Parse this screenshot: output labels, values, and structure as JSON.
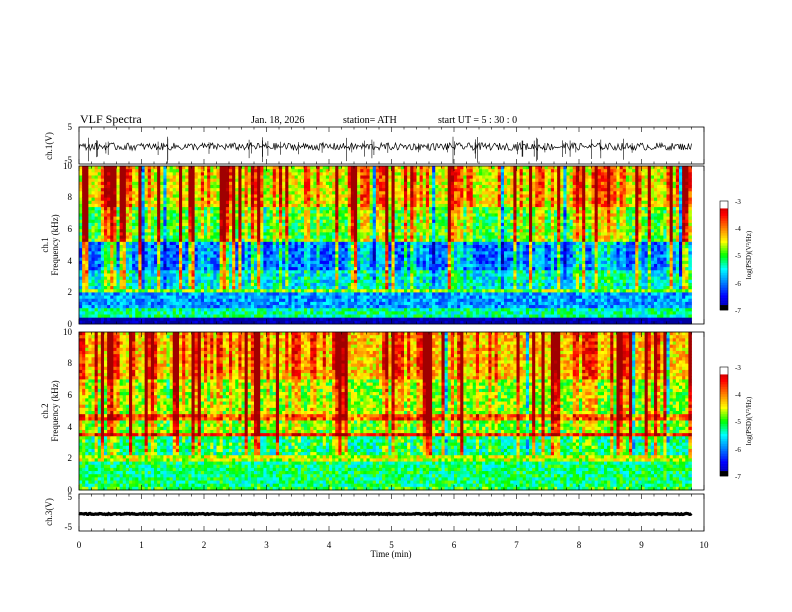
{
  "header": {
    "title": "VLF  Spectra",
    "date": "Jan. 18, 2026",
    "station": "station= ATH",
    "start_ut": "start  UT  =   5  : 30 : 0"
  },
  "colors": {
    "colormap": [
      "#000000",
      "#0000a0",
      "#0000ff",
      "#0080ff",
      "#00ffff",
      "#00ff00",
      "#ffff00",
      "#ff8000",
      "#ff0000",
      "#a00000",
      "#ffffff"
    ],
    "trace": "#000000",
    "frame": "#000000"
  },
  "chart_data": [
    {
      "type": "line",
      "panel": "ch1-waveform",
      "ylabel": "ch.1(V)",
      "ylim": [
        -5,
        5
      ],
      "yticks": [
        "5",
        "-5"
      ],
      "x_range_min": [
        0,
        9.8
      ],
      "level_mean_v": -0.3,
      "noise_amplitude_v": 1.0
    },
    {
      "type": "heatmap",
      "panel": "ch1-spectrogram",
      "ylabel_line1": "ch.1",
      "ylabel_line2": "Frequency  (kHz)",
      "ylim": [
        0,
        10
      ],
      "yticks": [
        "0",
        "2",
        "4",
        "6",
        "8",
        "10"
      ],
      "x_range_min": [
        0,
        9.8
      ],
      "colorbar": {
        "label": "log(PSD)(V²/Hz)",
        "range": [
          -7,
          -3
        ],
        "ticks": [
          "-3",
          "-4",
          "-5",
          "-6",
          "-7"
        ]
      },
      "bands_khz_logpsd": [
        {
          "f": [
            0,
            0.4
          ],
          "v": -7.0
        },
        {
          "f": [
            0.4,
            1.0
          ],
          "v": -5.3
        },
        {
          "f": [
            1.0,
            2.0
          ],
          "v": -5.9
        },
        {
          "f": [
            2.0,
            2.3
          ],
          "v": -4.8
        },
        {
          "f": [
            2.3,
            3.5
          ],
          "v": -5.6
        },
        {
          "f": [
            3.5,
            5.2
          ],
          "v": -6.1
        },
        {
          "f": [
            5.2,
            7.5
          ],
          "v": -5.0
        },
        {
          "f": [
            7.5,
            10.0
          ],
          "v": -4.5
        }
      ]
    },
    {
      "type": "heatmap",
      "panel": "ch2-spectrogram",
      "ylabel_line1": "ch.2",
      "ylabel_line2": "Frequency  (kHz)",
      "ylim": [
        0,
        10
      ],
      "yticks": [
        "0",
        "2",
        "4",
        "6",
        "8",
        "10"
      ],
      "x_range_min": [
        0,
        9.8
      ],
      "colorbar": {
        "label": "log(PSD)(V²/Hz)",
        "range": [
          -7,
          -3
        ],
        "ticks": [
          "-3",
          "-4",
          "-5",
          "-6",
          "-7"
        ]
      },
      "bands_khz_logpsd": [
        {
          "f": [
            0,
            0.3
          ],
          "v": -5.0
        },
        {
          "f": [
            0.3,
            1.8
          ],
          "v": -5.2
        },
        {
          "f": [
            1.8,
            2.3
          ],
          "v": -4.6
        },
        {
          "f": [
            2.3,
            3.4
          ],
          "v": -5.3
        },
        {
          "f": [
            3.4,
            3.7
          ],
          "v": -3.8
        },
        {
          "f": [
            3.7,
            4.5
          ],
          "v": -4.9
        },
        {
          "f": [
            4.5,
            4.7
          ],
          "v": -4.0
        },
        {
          "f": [
            4.7,
            7.0
          ],
          "v": -4.8
        },
        {
          "f": [
            7.0,
            10.0
          ],
          "v": -4.3
        }
      ]
    },
    {
      "type": "line",
      "panel": "ch3-waveform",
      "ylabel": "ch.3(V)",
      "ylim": [
        -5,
        5
      ],
      "yticks": [
        "5",
        "-5"
      ],
      "x_range_min": [
        0,
        9.8
      ],
      "level_mean_v": -0.4,
      "noise_amplitude_v": 0.15
    }
  ],
  "xaxis": {
    "label": "Time  (min)",
    "range": [
      0,
      10
    ],
    "ticks": [
      "0",
      "1",
      "2",
      "3",
      "4",
      "5",
      "6",
      "7",
      "8",
      "9",
      "10"
    ]
  }
}
